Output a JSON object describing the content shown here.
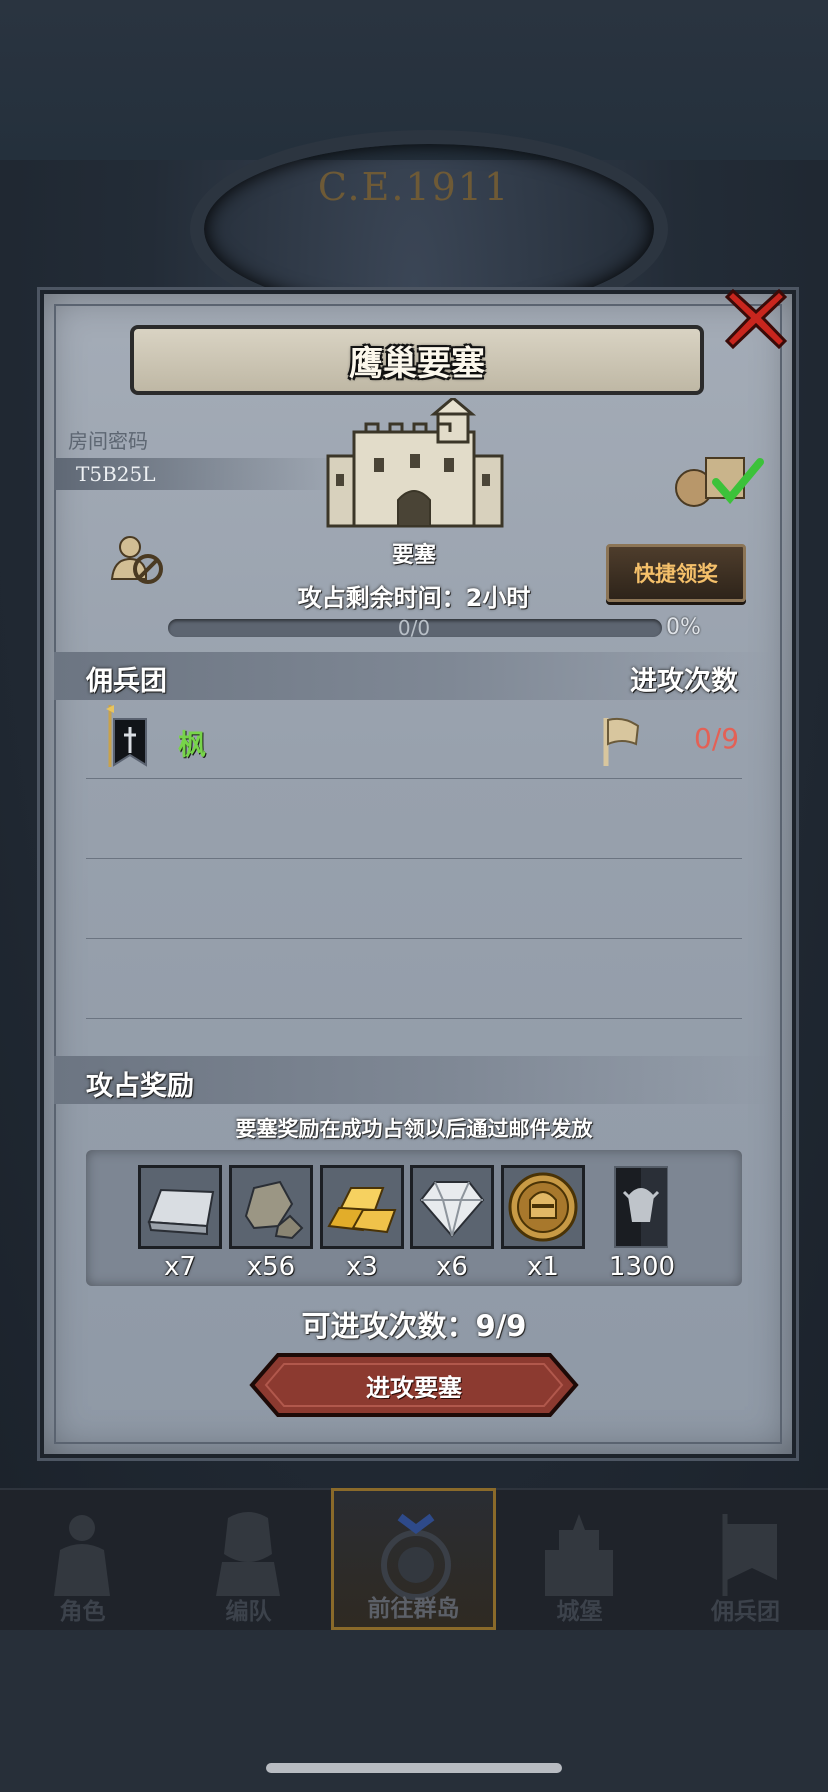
{
  "background": {
    "era": "C.E.1911"
  },
  "dialog": {
    "title": "鹰巢要塞",
    "room_code_label": "房间密码",
    "room_code": "T5B25L",
    "fortress_label": "要塞",
    "quick_claim": "快捷领奖",
    "time_label": "攻占剩余时间：",
    "time_value": "2小时",
    "progress_text": "0/0",
    "progress_pct": "0%",
    "progress_fraction": 0,
    "mercenary_header": "佣兵团",
    "attacks_header": "进攻次数",
    "mercenaries": [
      {
        "name": "枫",
        "attacks": "0/9"
      }
    ],
    "reward_header": "攻占奖励",
    "reward_note": "要塞奖励在成功占领以后通过邮件发放",
    "rewards": [
      {
        "icon": "iron-ingot-icon",
        "qty": "x7"
      },
      {
        "icon": "stone-icon",
        "qty": "x56"
      },
      {
        "icon": "gold-bars-icon",
        "qty": "x3"
      },
      {
        "icon": "diamond-icon",
        "qty": "x6"
      },
      {
        "icon": "knight-medal-icon",
        "qty": "x1"
      },
      {
        "icon": "mercenary-exp-banner-icon",
        "qty": "1300"
      }
    ],
    "remaining_label": "可进攻次数：",
    "remaining_value": "9/9",
    "attack_button": "进攻要塞"
  },
  "nav": [
    {
      "label": "角色",
      "icon": "character-icon"
    },
    {
      "label": "编队",
      "icon": "formation-icon"
    },
    {
      "label": "前往群岛",
      "icon": "compass-icon",
      "active": true
    },
    {
      "label": "城堡",
      "icon": "castle-icon"
    },
    {
      "label": "佣兵团",
      "icon": "mercenary-icon"
    }
  ],
  "colors": {
    "accent_gold": "#f5c06a",
    "merc_name": "#77d44a",
    "attack_count": "#e36156",
    "attack_button": "#8c3a30"
  }
}
